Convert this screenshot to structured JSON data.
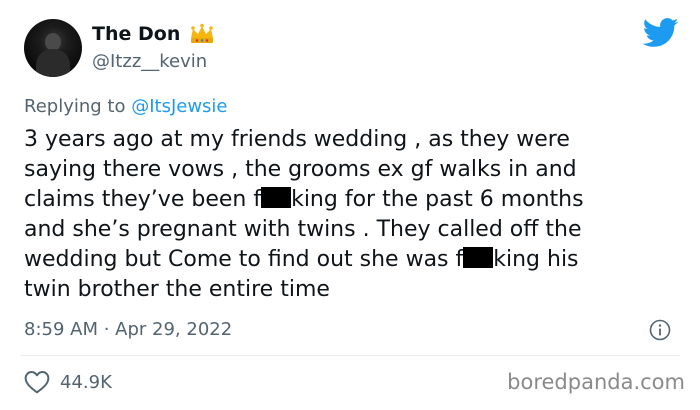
{
  "author": {
    "name": "The Don",
    "handle": "@Itzz__kevin",
    "badge_icon": "crown-icon"
  },
  "reply": {
    "prefix": "Replying to ",
    "mention": "@ItsJewsie"
  },
  "tweet": {
    "part1": "3 years ago at my friends wedding , as they were\nsaying there vows , the grooms ex gf walks in and\nclaims they’ve been f",
    "part2": "king for the past 6 months\nand she’s pregnant with twins . They called off the\nwedding but Come to find out she was f",
    "part3": "king his\ntwin brother the entire time"
  },
  "meta": {
    "timestamp": "8:59 AM · Apr 29, 2022"
  },
  "stats": {
    "likes": "44.9K"
  },
  "watermark": "boredpanda.com",
  "colors": {
    "twitter_blue": "#1d9bf0",
    "muted_text": "#536471",
    "crown_gold": "#f5b60f"
  }
}
